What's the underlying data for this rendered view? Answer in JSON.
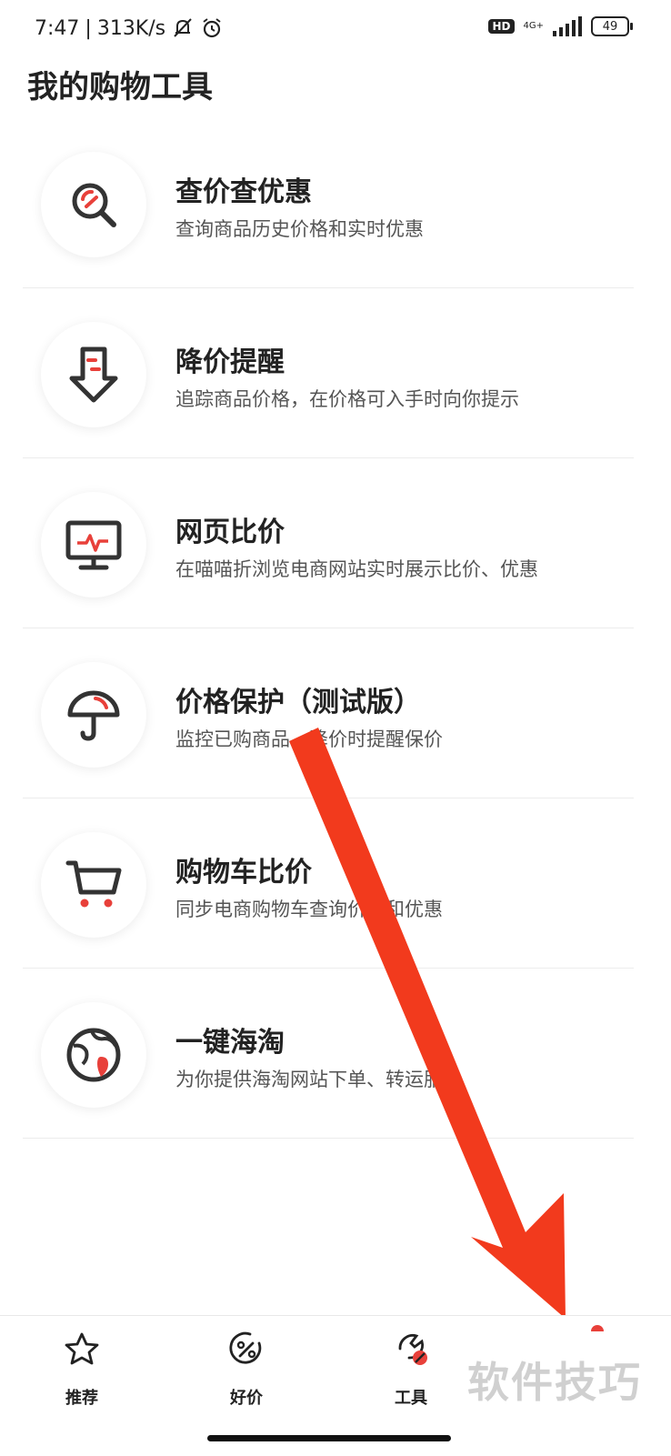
{
  "status": {
    "time": "7:47",
    "separator": "|",
    "speed": "313K/s",
    "hd": "HD",
    "network": "4G+",
    "battery": "49"
  },
  "page": {
    "title": "我的购物工具"
  },
  "tools": [
    {
      "title": "查价查优惠",
      "desc": "查询商品历史价格和实时优惠",
      "icon": "magnifier-icon"
    },
    {
      "title": "降价提醒",
      "desc": "追踪商品价格，在价格可入手时向你提示",
      "icon": "down-arrow-icon"
    },
    {
      "title": "网页比价",
      "desc": "在喵喵折浏览电商网站实时展示比价、优惠",
      "icon": "monitor-icon"
    },
    {
      "title": "价格保护（测试版）",
      "desc": "监控已购商品，降价时提醒保价",
      "icon": "umbrella-icon"
    },
    {
      "title": "购物车比价",
      "desc": "同步电商购物车查询价格和优惠",
      "icon": "cart-icon"
    },
    {
      "title": "一键海淘",
      "desc": "为你提供海淘网站下单、转运服务",
      "icon": "globe-icon"
    }
  ],
  "nav": [
    {
      "label": "推荐",
      "icon": "star-icon"
    },
    {
      "label": "好价",
      "icon": "discount-icon"
    },
    {
      "label": "工具",
      "icon": "tool-icon",
      "active": true
    }
  ],
  "watermark": "软件技巧",
  "colors": {
    "accent": "#e8403a",
    "annotation_arrow": "#f23a1d",
    "text": "#222222"
  }
}
